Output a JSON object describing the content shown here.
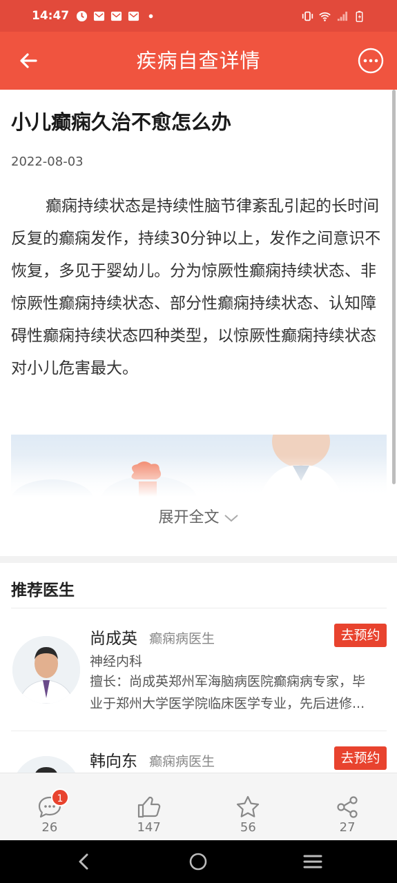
{
  "status_bar": {
    "time": "14:47",
    "icons_left": [
      "alarm-icon",
      "mail-icon",
      "mail-icon",
      "mail-icon",
      "dot-icon"
    ],
    "icons_right": [
      "vibrate-icon",
      "wifi-icon",
      "signal-icon",
      "battery-icon"
    ]
  },
  "app_bar": {
    "title": "疾病自查详情",
    "back_icon": "arrow-left-icon",
    "more_icon": "more-circle-icon"
  },
  "article": {
    "title": "小儿癫痫久治不愈怎么办",
    "date": "2022-08-03",
    "body": "癫痫持续状态是持续性脑节律紊乱引起的长时间反复的癫痫发作，持续30分钟以上，发作之间意识不恢复，多见于婴幼儿。分为惊厥性癫痫持续状态、非惊厥性癫痫持续状态、部分性癫痫持续状态、认知障碍性癫痫持续状态四种类型，以惊厥性癫痫持续状态对小儿危害最大。",
    "expand_label": "展开全文"
  },
  "recommend": {
    "heading": "推荐医生",
    "doctors": [
      {
        "name": "尚成英",
        "title": "癫痫病医生",
        "dept": "神经内科",
        "skill_line1": "擅长：尚成英郑州军海脑病医院癫痫病专家，毕",
        "skill_line2": "业于郑州大学医学院临床医学专业，先后进修...",
        "book_label": "去预约"
      },
      {
        "name": "韩向东",
        "title": "癫痫病医生",
        "book_label": "去预约"
      }
    ]
  },
  "bottom_bar": {
    "comments": {
      "count": "26",
      "badge": "1"
    },
    "likes": {
      "count": "147"
    },
    "favorites": {
      "count": "56"
    },
    "shares": {
      "count": "27"
    }
  },
  "colors": {
    "status_bar": "#e24a3b",
    "app_bar": "#f0543f",
    "accent": "#e8432e"
  }
}
